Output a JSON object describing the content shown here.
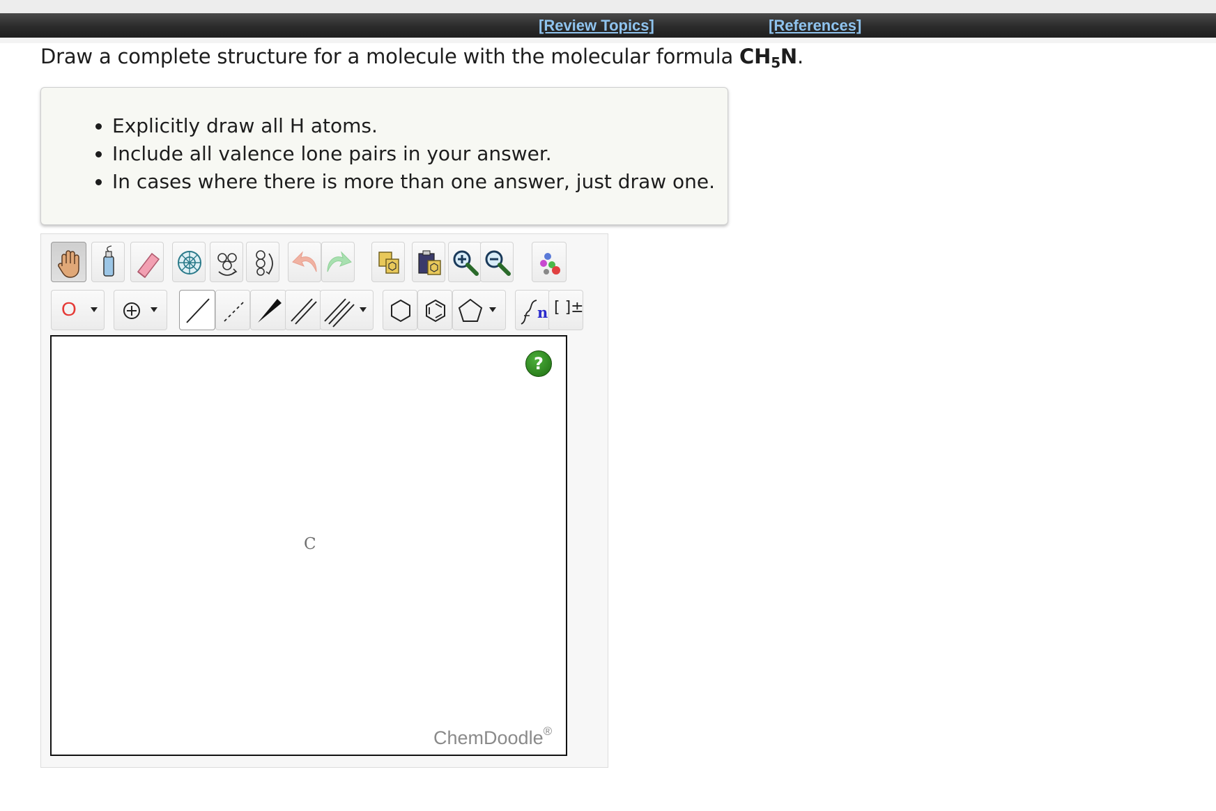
{
  "nav": {
    "review_topics": "[Review Topics]",
    "references": "[References]"
  },
  "question": {
    "prefix": "Draw a complete structure for a molecule with the molecular formula ",
    "formula_main1": "CH",
    "formula_sub": "5",
    "formula_main2": "N",
    "suffix": "."
  },
  "instructions": [
    "Explicitly draw all H atoms.",
    "Include all valence lone pairs in your answer.",
    "In cases where there is more than one answer, just draw one."
  ],
  "toolbar": {
    "atom_label": "O",
    "charge_label": "⊕",
    "bracket_label": "[ ]±",
    "repeat_label": "n",
    "icons": [
      "hand-icon",
      "lasso-icon",
      "eraser-icon",
      "center-icon",
      "flip-horizontal-icon",
      "flip-vertical-icon",
      "undo-icon",
      "redo-icon",
      "copy-icon",
      "paste-icon",
      "zoom-in-icon",
      "zoom-out-icon",
      "clean-icon",
      "atom-icon",
      "charge-icon",
      "single-bond-icon",
      "dashed-bond-icon",
      "wedge-bond-icon",
      "double-bond-icon",
      "triple-bond-icon",
      "cyclohexane-icon",
      "benzene-icon",
      "cyclopentane-icon",
      "repeat-unit-icon",
      "bracket-icon"
    ]
  },
  "canvas": {
    "atom_symbol": "C",
    "help_symbol": "?",
    "watermark": "ChemDoodle",
    "watermark_mark": "®"
  },
  "colors": {
    "link": "#8fc3ee",
    "help_green": "#2e8b1f",
    "atom_red": "#e53935"
  }
}
